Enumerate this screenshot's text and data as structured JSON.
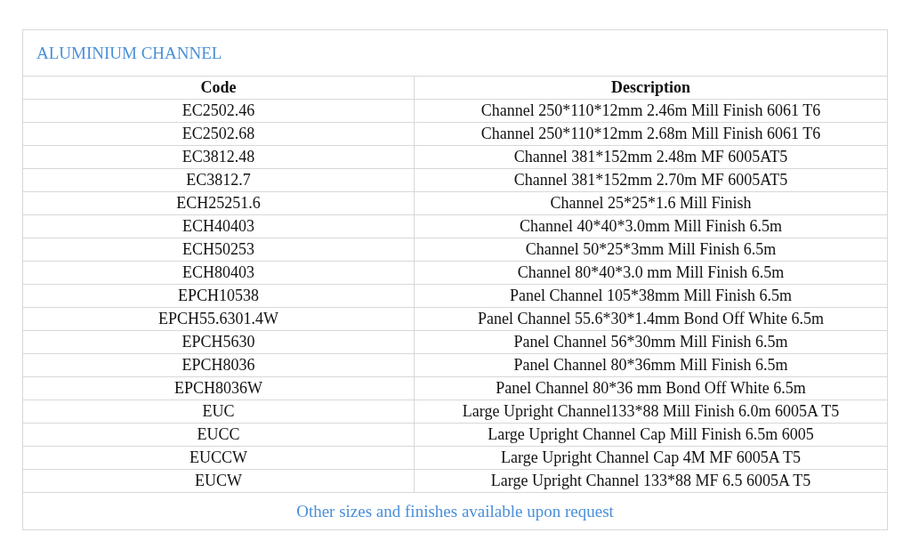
{
  "title": "ALUMINIUM CHANNEL",
  "columns": [
    "Code",
    "Description"
  ],
  "rows": [
    [
      "EC2502.46",
      "Channel 250*110*12mm 2.46m Mill Finish 6061 T6"
    ],
    [
      "EC2502.68",
      "Channel 250*110*12mm 2.68m Mill Finish 6061 T6"
    ],
    [
      "EC3812.48",
      "Channel 381*152mm 2.48m MF 6005AT5"
    ],
    [
      "EC3812.7",
      "Channel 381*152mm 2.70m MF 6005AT5"
    ],
    [
      "ECH25251.6",
      "Channel 25*25*1.6 Mill Finish"
    ],
    [
      "ECH40403",
      "Channel 40*40*3.0mm Mill Finish 6.5m"
    ],
    [
      "ECH50253",
      "Channel 50*25*3mm Mill Finish 6.5m"
    ],
    [
      "ECH80403",
      "Channel 80*40*3.0 mm Mill Finish 6.5m"
    ],
    [
      "EPCH10538",
      "Panel Channel 105*38mm Mill Finish 6.5m"
    ],
    [
      "EPCH55.6301.4W",
      "Panel Channel 55.6*30*1.4mm Bond Off White 6.5m"
    ],
    [
      "EPCH5630",
      "Panel Channel 56*30mm Mill Finish 6.5m"
    ],
    [
      "EPCH8036",
      "Panel Channel 80*36mm Mill Finish 6.5m"
    ],
    [
      "EPCH8036W",
      "Panel Channel 80*36 mm Bond Off White 6.5m"
    ],
    [
      "EUC",
      "Large Upright Channel133*88 Mill Finish 6.0m 6005A T5"
    ],
    [
      "EUCC",
      "Large Upright Channel Cap Mill Finish 6.5m 6005"
    ],
    [
      "EUCCW",
      "Large Upright Channel Cap 4M MF 6005A T5"
    ],
    [
      "EUCW",
      "Large Upright Channel 133*88 MF 6.5 6005A T5"
    ]
  ],
  "footer": "Other sizes and finishes available upon request"
}
